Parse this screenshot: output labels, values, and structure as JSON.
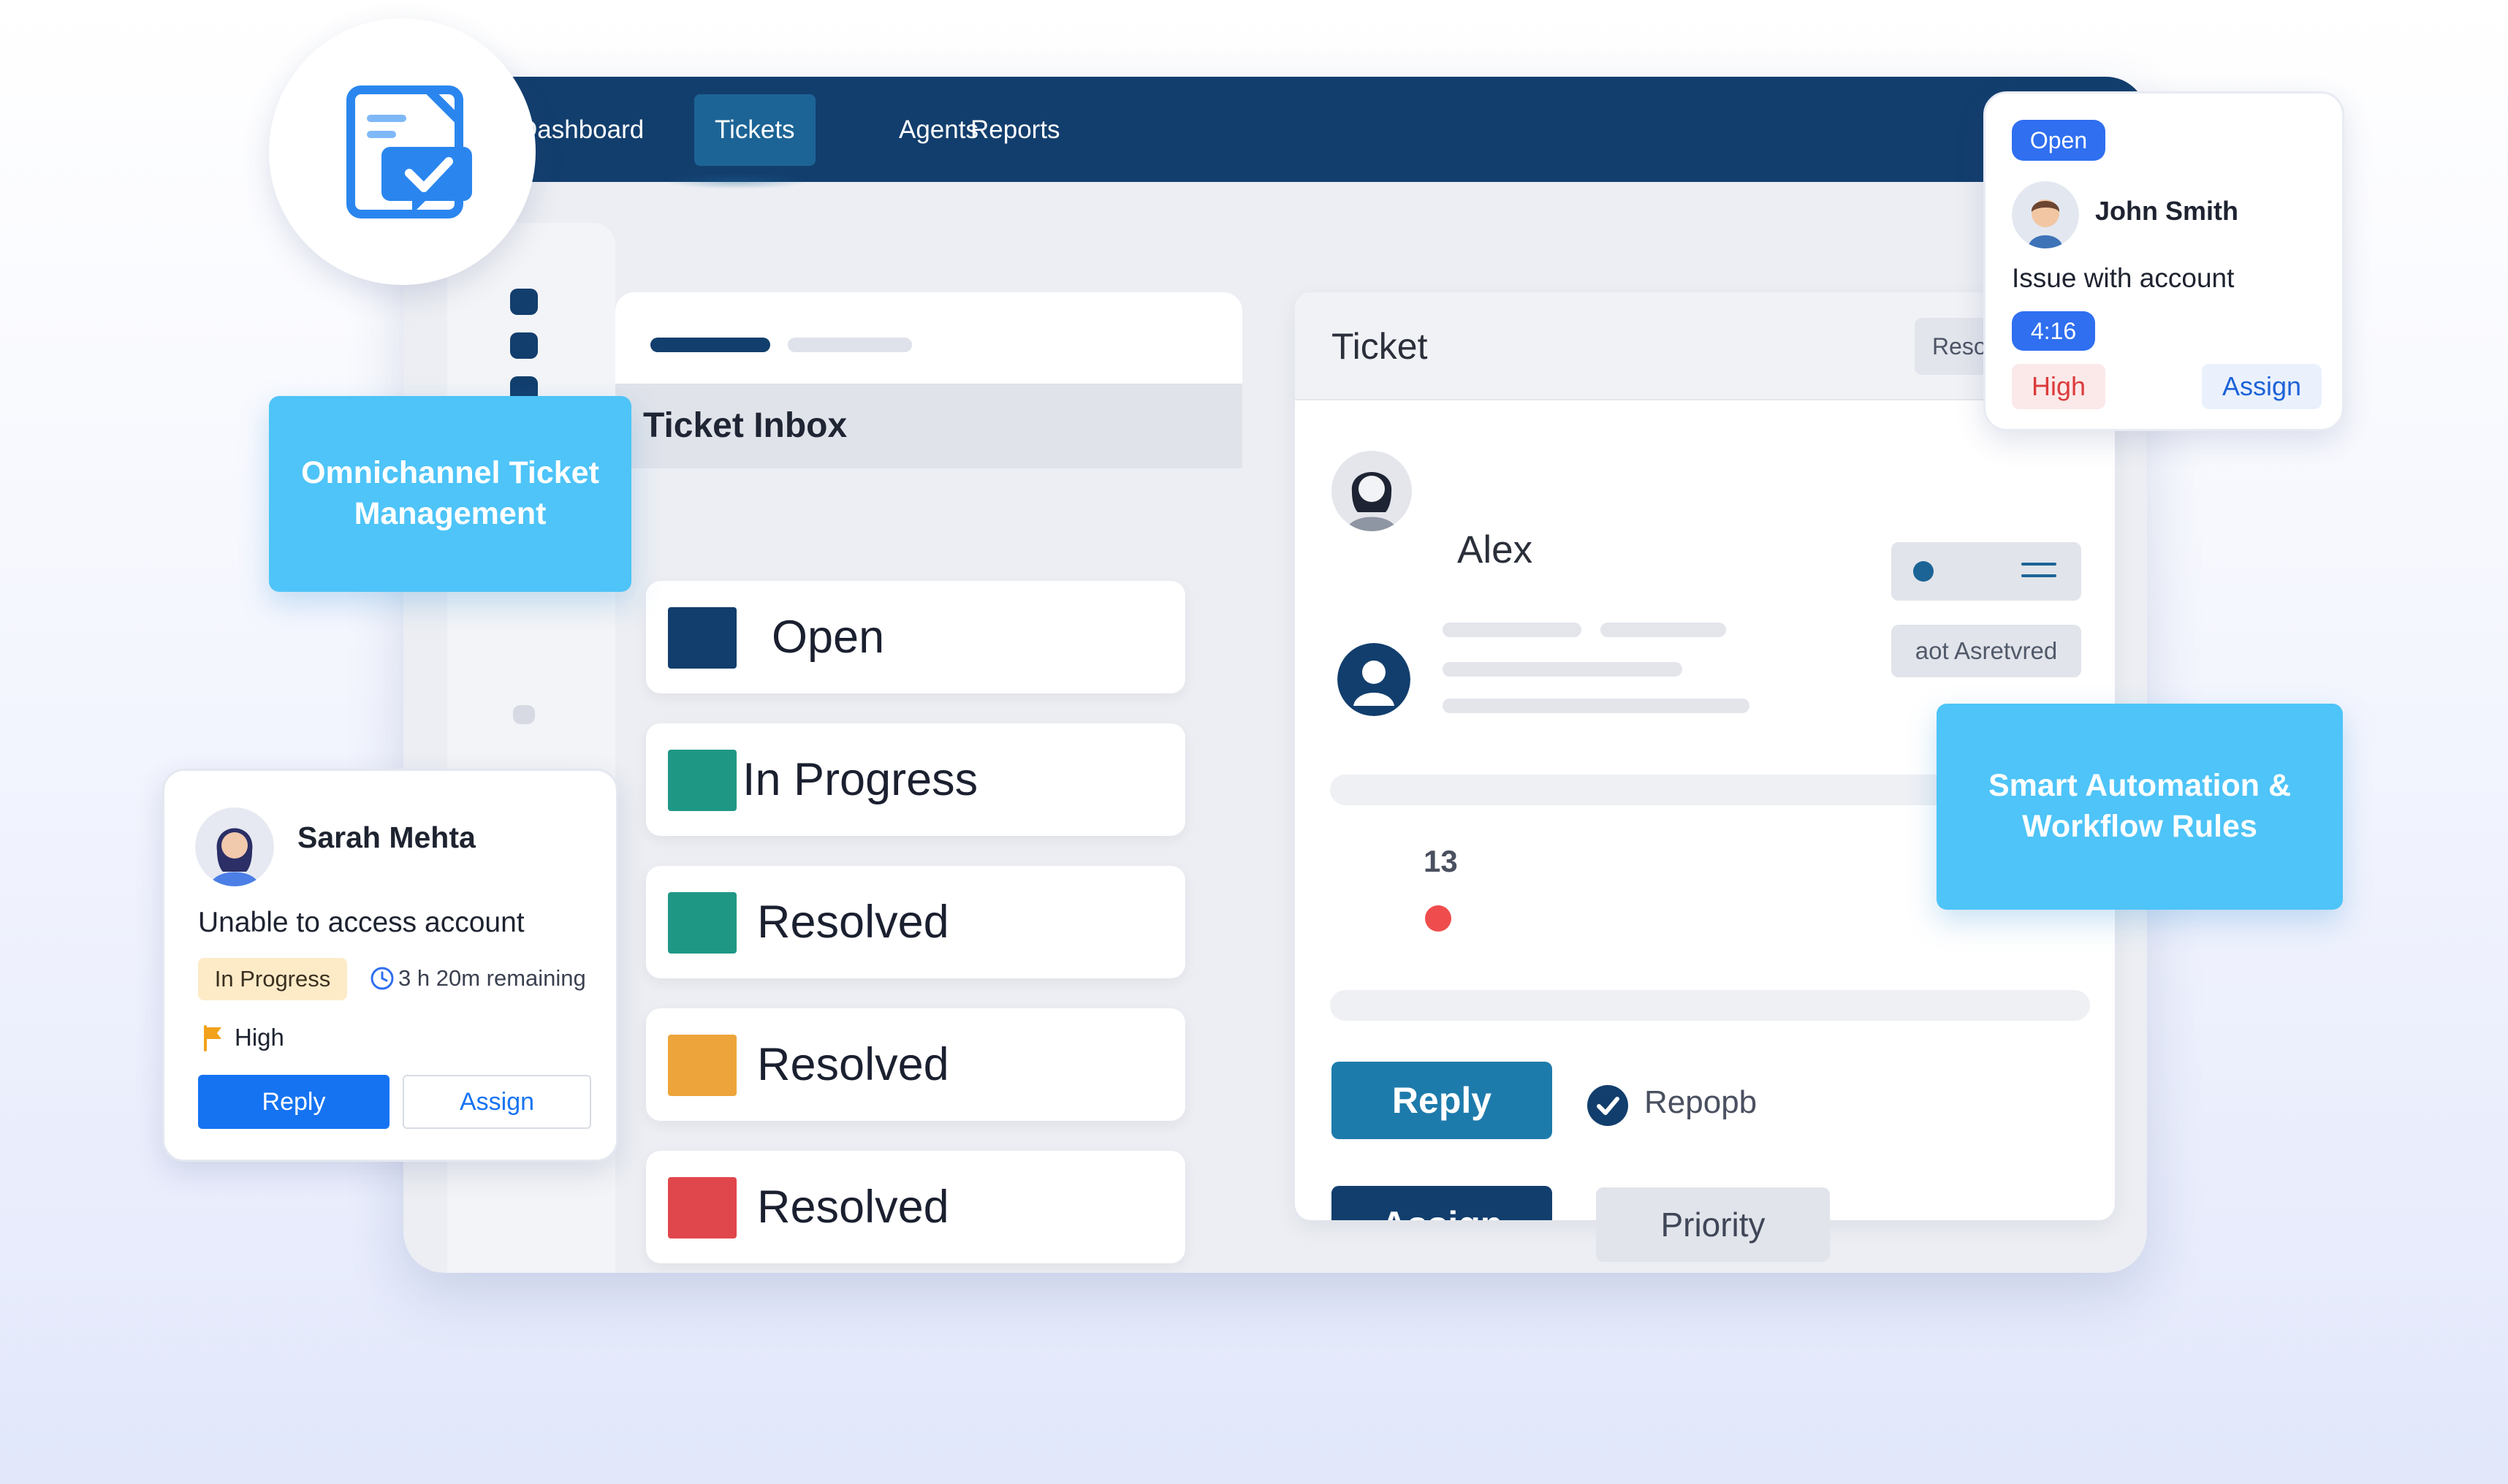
{
  "nav": {
    "items": [
      {
        "label": "Dashboard",
        "active": false
      },
      {
        "label": "Tickets",
        "active": true
      },
      {
        "label": "Agents",
        "active": false
      },
      {
        "label": "Reports",
        "active": false
      }
    ]
  },
  "feature_badges": {
    "left": "Omnichannel Ticket Management",
    "right": "Smart Automation & Workflow Rules"
  },
  "inbox": {
    "title": "Ticket Inbox",
    "statuses": [
      {
        "label": "Open",
        "color": "#123e6d"
      },
      {
        "label": "In Progress",
        "color": "#1f9785"
      },
      {
        "label": "Resolved",
        "color": "#1f9785"
      },
      {
        "label": "Resolved",
        "color": "#eda43a"
      },
      {
        "label": "Resolved",
        "color": "#e0474c"
      }
    ]
  },
  "ticket_panel": {
    "title": "Ticket",
    "tab_label": "Resolved",
    "customer_name": "Alex",
    "status_chip": "aot Asretvred",
    "edge_number": "13",
    "actions": {
      "reply": "Reply",
      "assign": "Assign",
      "priority": "Priority",
      "checkbox_label": "Repoрb"
    }
  },
  "card_john": {
    "status": "Open",
    "name": "John Smith",
    "issue": "Issue with account",
    "timer": "4:16",
    "priority": "High",
    "assign": "Assign"
  },
  "card_sarah": {
    "name": "Sarah Mehta",
    "issue": "Unable to access account",
    "status": "In Progress",
    "remaining": "3 h 20m remaining",
    "priority": "High",
    "reply": "Reply",
    "assign": "Assign"
  },
  "colors": {
    "navy": "#123e6d",
    "accent_blue": "#1573f2",
    "badge_cyan": "#4ec4f8",
    "teal": "#1f9785",
    "amber": "#eda43a",
    "red": "#e0474c"
  }
}
